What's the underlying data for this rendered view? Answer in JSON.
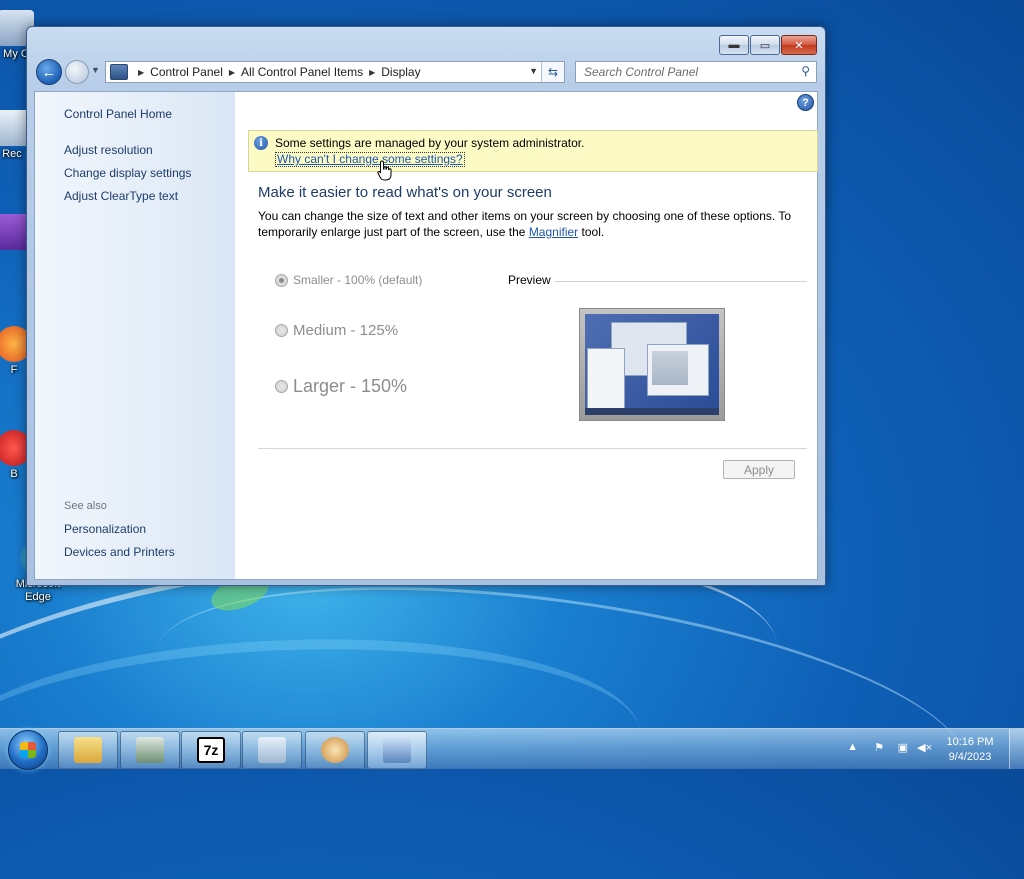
{
  "desktop": {
    "icons": [
      {
        "label": "My C",
        "icon": "computer-icon"
      },
      {
        "label": "Rec",
        "icon": "recycle-bin-icon"
      },
      {
        "label": "",
        "icon": "app-shortcut-icon"
      },
      {
        "label": "F",
        "icon": "firefox-icon"
      },
      {
        "label": "B",
        "icon": "browser-icon"
      },
      {
        "label": "Microsoft Edge",
        "icon": "edge-icon"
      }
    ]
  },
  "window": {
    "breadcrumb": [
      "Control Panel",
      "All Control Panel Items",
      "Display"
    ],
    "search_placeholder": "Search Control Panel",
    "sidebar": {
      "home": "Control Panel Home",
      "links": [
        "Adjust resolution",
        "Change display settings",
        "Adjust ClearType text"
      ],
      "see_also_label": "See also",
      "see_also_links": [
        "Personalization",
        "Devices and Printers"
      ]
    },
    "info_bar": {
      "message": "Some settings are managed by your system administrator.",
      "link": "Why can't I change some settings?"
    },
    "heading": "Make it easier to read what's on your screen",
    "description_before": "You can change the size of text and other items on your screen by choosing one of these options. To temporarily enlarge just part of the screen, use the ",
    "description_link": "Magnifier",
    "description_after": " tool.",
    "options": [
      {
        "label": "Smaller - 100% (default)",
        "checked": true,
        "enabled": false
      },
      {
        "label": "Medium - 125%",
        "checked": false,
        "enabled": false
      },
      {
        "label": "Larger - 150%",
        "checked": false,
        "enabled": false
      }
    ],
    "preview_label": "Preview",
    "apply_label": "Apply",
    "apply_enabled": false
  },
  "taskbar": {
    "apps": [
      "explorer-icon",
      "task-manager-icon",
      "7zip-icon",
      "notepad-icon",
      "paint-icon",
      "control-panel-icon"
    ],
    "seven_zip_text": "7z",
    "clock": {
      "time": "10:16 PM",
      "date": "9/4/2023"
    }
  },
  "colors": {
    "link": "#1f57b0",
    "heading": "#1e3c6b",
    "info_bg": "#fcfbc6"
  }
}
